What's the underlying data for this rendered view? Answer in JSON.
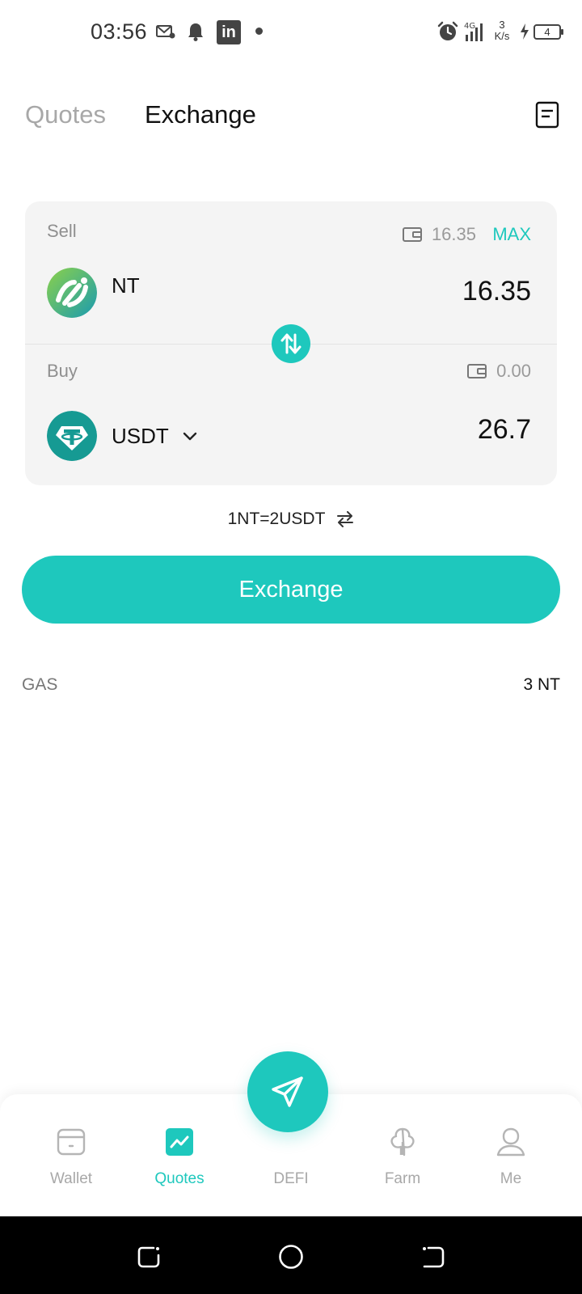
{
  "status_bar": {
    "time": "03:56",
    "speed_value": "3",
    "speed_unit": "K/s",
    "battery": "4"
  },
  "header": {
    "tabs": [
      {
        "label": "Quotes",
        "active": false
      },
      {
        "label": "Exchange",
        "active": true
      }
    ]
  },
  "swap": {
    "sell": {
      "label": "Sell",
      "balance": "16.35",
      "max_label": "MAX",
      "token": "NT",
      "amount": "16.35"
    },
    "buy": {
      "label": "Buy",
      "balance": "0.00",
      "token": "USDT",
      "amount": "26.7"
    }
  },
  "rate": "1NT=2USDT",
  "exchange_button": "Exchange",
  "gas": {
    "label": "GAS",
    "value": "3 NT"
  },
  "colors": {
    "accent": "#1ec8bd",
    "card_bg": "#f4f4f4",
    "muted": "#a8a8a8"
  },
  "bottom_nav": {
    "items": [
      {
        "label": "Wallet",
        "icon": "wallet-icon"
      },
      {
        "label": "Quotes",
        "icon": "chart-icon",
        "active": true
      },
      {
        "label": "DEFI",
        "icon": "send-icon"
      },
      {
        "label": "Farm",
        "icon": "tree-icon"
      },
      {
        "label": "Me",
        "icon": "user-icon"
      }
    ]
  }
}
